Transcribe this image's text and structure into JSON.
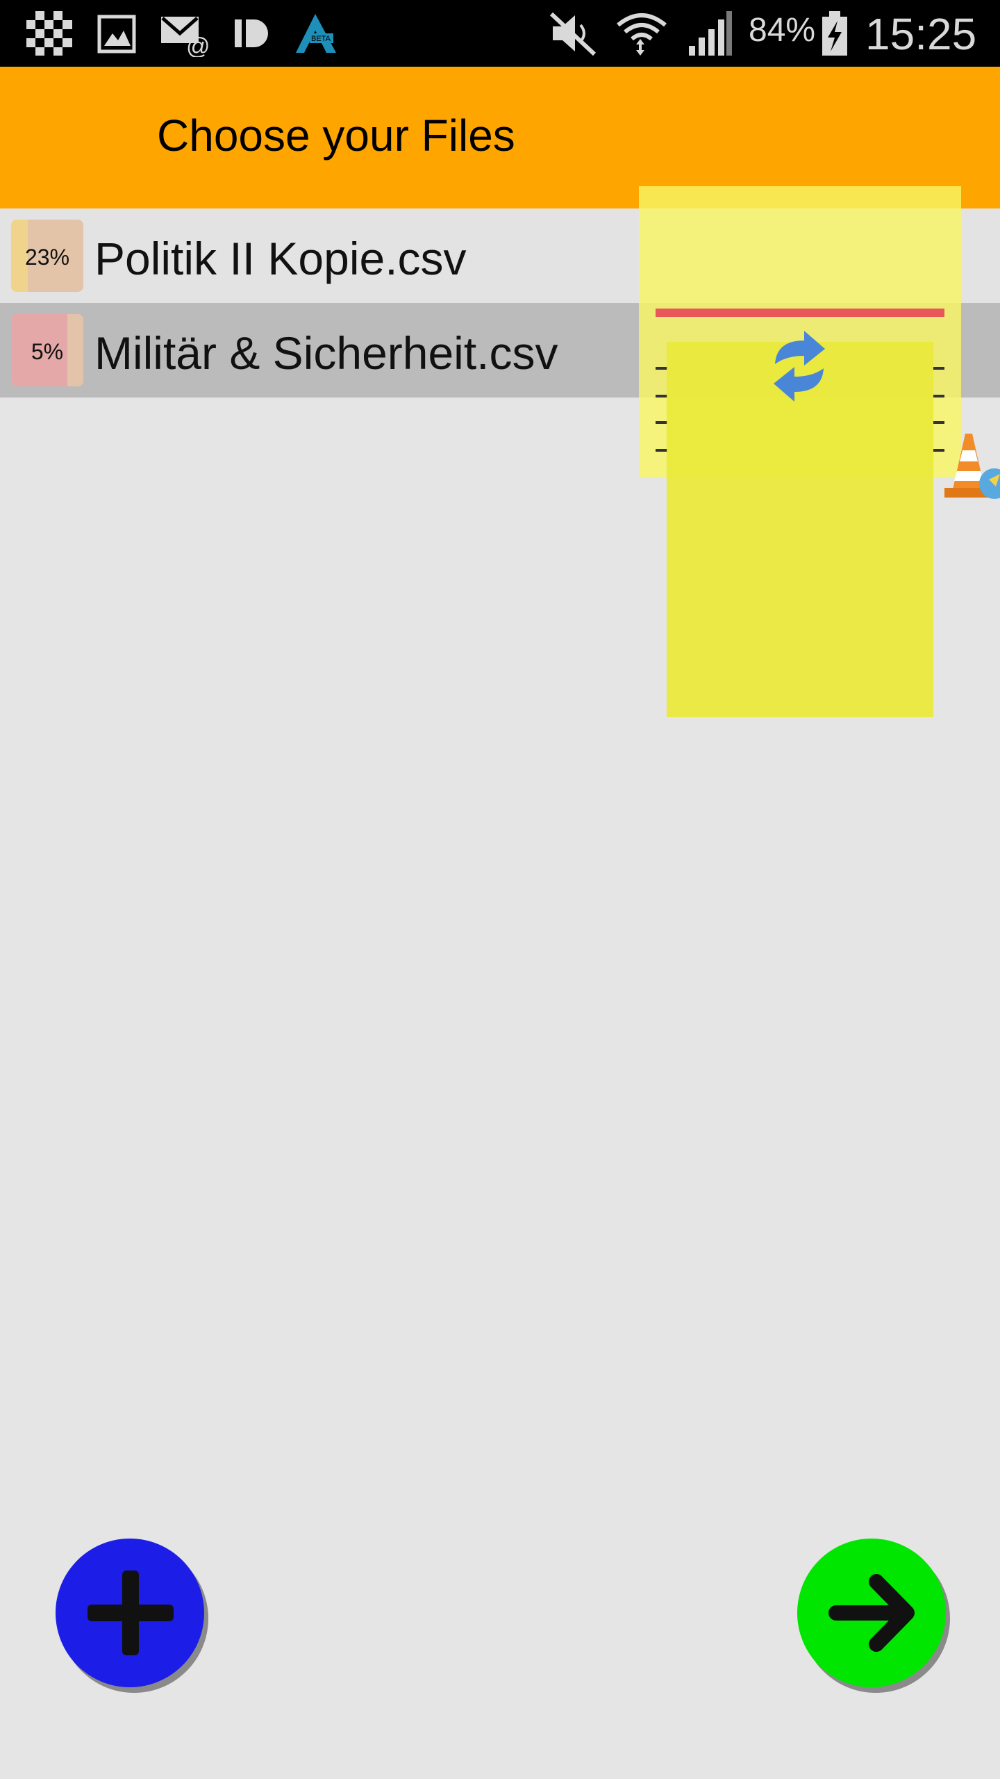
{
  "status_bar": {
    "icons": [
      "checkerboard-icon",
      "gallery-icon",
      "email-icon",
      "app-icon",
      "beta-app-icon",
      "mute-icon",
      "wifi-icon",
      "signal-icon",
      "battery-charging-icon"
    ],
    "beta_badge": "BETA",
    "battery": "84%",
    "time": "15:25"
  },
  "header": {
    "title": "Choose your Files",
    "color": "#ffa500"
  },
  "files": [
    {
      "name": "Politik II Kopie.csv",
      "progress_label": "23%",
      "progress": 0.23
    },
    {
      "name": "Militär & Sicherheit.csv",
      "progress_label": "5%",
      "progress": 0.05
    }
  ],
  "overlay": {
    "icons": [
      "sync-icon",
      "traffic-cone-icon"
    ]
  },
  "fabs": {
    "add": {
      "icon": "plus-icon",
      "color": "#1d1de8"
    },
    "next": {
      "icon": "arrow-right-icon",
      "color": "#00e600"
    }
  }
}
